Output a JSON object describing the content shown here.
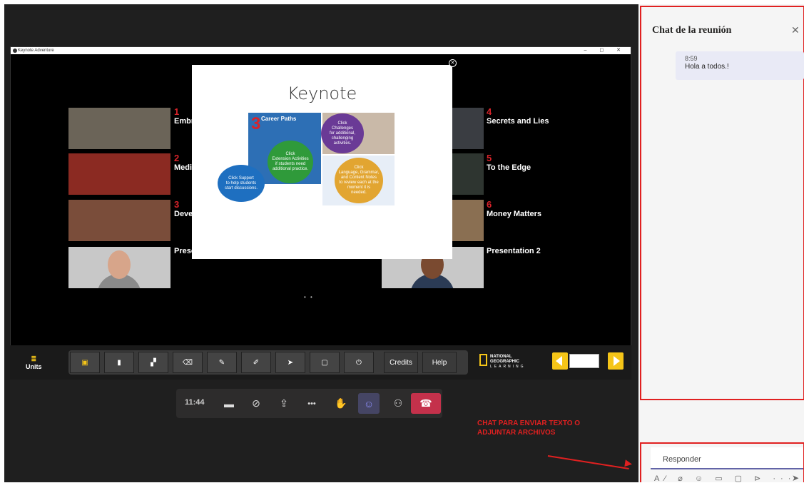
{
  "window": {
    "title": "Keynote Adventure",
    "controls": "– ◻ ✕"
  },
  "units": [
    {
      "num": "1",
      "title": "Embr",
      "color": "#6b6458"
    },
    {
      "num": "2",
      "title": "Medi",
      "color": "#8b2a22"
    },
    {
      "num": "3",
      "title": "Deve",
      "color": "#7a4d3a"
    },
    {
      "num": "4",
      "title": "Secrets and Lies",
      "color": "#3a3d42"
    },
    {
      "num": "5",
      "title": "To the Edge",
      "color": "#2e3530"
    },
    {
      "num": "6",
      "title": "Money Matters",
      "color": "#8a6f52"
    }
  ],
  "presentations": [
    {
      "title": "Prese"
    },
    {
      "title": "Presentation 2"
    }
  ],
  "popup": {
    "title": "Keynote",
    "close": "✕",
    "number": "3",
    "career_text": "Career Paths",
    "bubbles": [
      {
        "lines": [
          "Click",
          "Challenges",
          "for additional,",
          "challenging",
          "activities."
        ],
        "color": "#6a3a96"
      },
      {
        "lines": [
          "Click",
          "Extension Activities",
          "if students need",
          "additional practice."
        ],
        "color": "#2f9a3a"
      },
      {
        "lines": [
          "Click Support",
          "to help students",
          "start discussions."
        ],
        "color": "#1e6fc0"
      },
      {
        "lines": [
          "Click",
          "Language, Grammar,",
          "and Content Notes",
          "to review each at the",
          "moment it is",
          "needed."
        ],
        "color": "#e2a531"
      }
    ]
  },
  "pager": "• •",
  "toolbar": {
    "units_label": "Units",
    "units_icon": "≣",
    "tools": [
      "▣",
      "▮",
      "▞",
      "⌫",
      "✎",
      "✐",
      "➤",
      "▢",
      "⏻"
    ],
    "credits_label": "Credits",
    "help_label": "Help",
    "natgeo_text": "NATIONAL\nGEOGRAPHIC",
    "natgeo_sub": "LEARNING"
  },
  "call_bar": {
    "time": "11:44",
    "buttons": [
      "video-off-icon",
      "mic-off-icon",
      "share-tray-icon",
      "more-icon",
      "raise-hand-icon",
      "chat-icon",
      "participants-icon",
      "hang-up-icon"
    ],
    "glyphs": [
      "▬",
      "⊘",
      "⇪",
      "•••",
      "✋",
      "☺",
      "⚇",
      "☎"
    ]
  },
  "annotation": {
    "line1": "CHAT PARA ENVIAR TEXTO O",
    "line2": "ADJUNTAR ARCHIVOS",
    "color": "#e02020"
  },
  "chat": {
    "title": "Chat de la reunión",
    "close": "✕",
    "messages": [
      {
        "time": "8:59",
        "text": "Hola a todos.!"
      }
    ],
    "reply_placeholder": "Responder",
    "compose_icons": "A⁄ ⌀ ☺ ▭ ▢ ⊳ ···",
    "send": "➤"
  }
}
